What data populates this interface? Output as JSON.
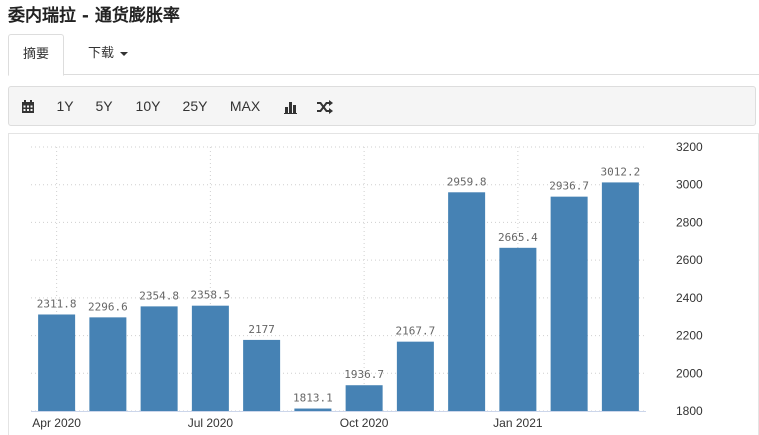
{
  "page": {
    "title": "委内瑞拉 - 通货膨胀率"
  },
  "tabs": {
    "summary": "摘要",
    "download": "下载"
  },
  "toolbar": {
    "buttons": [
      "1Y",
      "5Y",
      "10Y",
      "25Y",
      "MAX"
    ],
    "icons": [
      "calendar-icon",
      "bar-chart-icon",
      "shuffle-icon"
    ]
  },
  "colors": {
    "bar": "#4682b4"
  },
  "chart_data": {
    "type": "bar",
    "x": [
      "2020-04",
      "2020-05",
      "2020-06",
      "2020-07",
      "2020-08",
      "2020-09",
      "2020-10",
      "2020-11",
      "2020-12",
      "2021-01",
      "2021-02",
      "2021-03"
    ],
    "values": [
      2311.8,
      2296.6,
      2354.8,
      2358.5,
      2177,
      1813.1,
      1936.7,
      2167.7,
      2959.8,
      2665.4,
      2936.7,
      3012.2
    ],
    "data_labels": [
      "2311.8",
      "2296.6",
      "2354.8",
      "2358.5",
      "2177",
      "1813.1",
      "1936.7",
      "2167.7",
      "2959.8",
      "2665.4",
      "2936.7",
      "3012.2"
    ],
    "x_tick_labels": [
      {
        "index": 0,
        "label": "Apr 2020"
      },
      {
        "index": 3,
        "label": "Jul 2020"
      },
      {
        "index": 6,
        "label": "Oct 2020"
      },
      {
        "index": 9,
        "label": "Jan 2021"
      }
    ],
    "y_ticks": [
      1800,
      2000,
      2200,
      2400,
      2600,
      2800,
      3000,
      3200
    ],
    "ylim": [
      1800,
      3200
    ],
    "y_axis_side": "right",
    "grid": true,
    "title": "",
    "xlabel": "",
    "ylabel": ""
  }
}
